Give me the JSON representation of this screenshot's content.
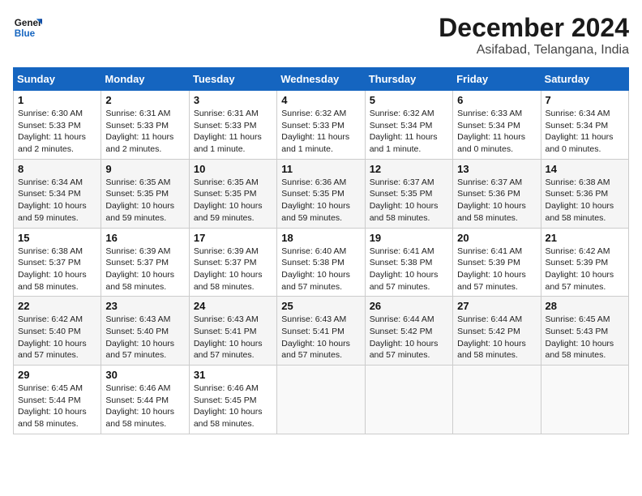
{
  "header": {
    "logo_line1": "General",
    "logo_line2": "Blue",
    "month": "December 2024",
    "location": "Asifabad, Telangana, India"
  },
  "weekdays": [
    "Sunday",
    "Monday",
    "Tuesday",
    "Wednesday",
    "Thursday",
    "Friday",
    "Saturday"
  ],
  "weeks": [
    [
      {
        "day": "1",
        "info": "Sunrise: 6:30 AM\nSunset: 5:33 PM\nDaylight: 11 hours\nand 2 minutes."
      },
      {
        "day": "2",
        "info": "Sunrise: 6:31 AM\nSunset: 5:33 PM\nDaylight: 11 hours\nand 2 minutes."
      },
      {
        "day": "3",
        "info": "Sunrise: 6:31 AM\nSunset: 5:33 PM\nDaylight: 11 hours\nand 1 minute."
      },
      {
        "day": "4",
        "info": "Sunrise: 6:32 AM\nSunset: 5:33 PM\nDaylight: 11 hours\nand 1 minute."
      },
      {
        "day": "5",
        "info": "Sunrise: 6:32 AM\nSunset: 5:34 PM\nDaylight: 11 hours\nand 1 minute."
      },
      {
        "day": "6",
        "info": "Sunrise: 6:33 AM\nSunset: 5:34 PM\nDaylight: 11 hours\nand 0 minutes."
      },
      {
        "day": "7",
        "info": "Sunrise: 6:34 AM\nSunset: 5:34 PM\nDaylight: 11 hours\nand 0 minutes."
      }
    ],
    [
      {
        "day": "8",
        "info": "Sunrise: 6:34 AM\nSunset: 5:34 PM\nDaylight: 10 hours\nand 59 minutes."
      },
      {
        "day": "9",
        "info": "Sunrise: 6:35 AM\nSunset: 5:35 PM\nDaylight: 10 hours\nand 59 minutes."
      },
      {
        "day": "10",
        "info": "Sunrise: 6:35 AM\nSunset: 5:35 PM\nDaylight: 10 hours\nand 59 minutes."
      },
      {
        "day": "11",
        "info": "Sunrise: 6:36 AM\nSunset: 5:35 PM\nDaylight: 10 hours\nand 59 minutes."
      },
      {
        "day": "12",
        "info": "Sunrise: 6:37 AM\nSunset: 5:35 PM\nDaylight: 10 hours\nand 58 minutes."
      },
      {
        "day": "13",
        "info": "Sunrise: 6:37 AM\nSunset: 5:36 PM\nDaylight: 10 hours\nand 58 minutes."
      },
      {
        "day": "14",
        "info": "Sunrise: 6:38 AM\nSunset: 5:36 PM\nDaylight: 10 hours\nand 58 minutes."
      }
    ],
    [
      {
        "day": "15",
        "info": "Sunrise: 6:38 AM\nSunset: 5:37 PM\nDaylight: 10 hours\nand 58 minutes."
      },
      {
        "day": "16",
        "info": "Sunrise: 6:39 AM\nSunset: 5:37 PM\nDaylight: 10 hours\nand 58 minutes."
      },
      {
        "day": "17",
        "info": "Sunrise: 6:39 AM\nSunset: 5:37 PM\nDaylight: 10 hours\nand 58 minutes."
      },
      {
        "day": "18",
        "info": "Sunrise: 6:40 AM\nSunset: 5:38 PM\nDaylight: 10 hours\nand 57 minutes."
      },
      {
        "day": "19",
        "info": "Sunrise: 6:41 AM\nSunset: 5:38 PM\nDaylight: 10 hours\nand 57 minutes."
      },
      {
        "day": "20",
        "info": "Sunrise: 6:41 AM\nSunset: 5:39 PM\nDaylight: 10 hours\nand 57 minutes."
      },
      {
        "day": "21",
        "info": "Sunrise: 6:42 AM\nSunset: 5:39 PM\nDaylight: 10 hours\nand 57 minutes."
      }
    ],
    [
      {
        "day": "22",
        "info": "Sunrise: 6:42 AM\nSunset: 5:40 PM\nDaylight: 10 hours\nand 57 minutes."
      },
      {
        "day": "23",
        "info": "Sunrise: 6:43 AM\nSunset: 5:40 PM\nDaylight: 10 hours\nand 57 minutes."
      },
      {
        "day": "24",
        "info": "Sunrise: 6:43 AM\nSunset: 5:41 PM\nDaylight: 10 hours\nand 57 minutes."
      },
      {
        "day": "25",
        "info": "Sunrise: 6:43 AM\nSunset: 5:41 PM\nDaylight: 10 hours\nand 57 minutes."
      },
      {
        "day": "26",
        "info": "Sunrise: 6:44 AM\nSunset: 5:42 PM\nDaylight: 10 hours\nand 57 minutes."
      },
      {
        "day": "27",
        "info": "Sunrise: 6:44 AM\nSunset: 5:42 PM\nDaylight: 10 hours\nand 58 minutes."
      },
      {
        "day": "28",
        "info": "Sunrise: 6:45 AM\nSunset: 5:43 PM\nDaylight: 10 hours\nand 58 minutes."
      }
    ],
    [
      {
        "day": "29",
        "info": "Sunrise: 6:45 AM\nSunset: 5:44 PM\nDaylight: 10 hours\nand 58 minutes."
      },
      {
        "day": "30",
        "info": "Sunrise: 6:46 AM\nSunset: 5:44 PM\nDaylight: 10 hours\nand 58 minutes."
      },
      {
        "day": "31",
        "info": "Sunrise: 6:46 AM\nSunset: 5:45 PM\nDaylight: 10 hours\nand 58 minutes."
      },
      {
        "day": "",
        "info": ""
      },
      {
        "day": "",
        "info": ""
      },
      {
        "day": "",
        "info": ""
      },
      {
        "day": "",
        "info": ""
      }
    ]
  ]
}
